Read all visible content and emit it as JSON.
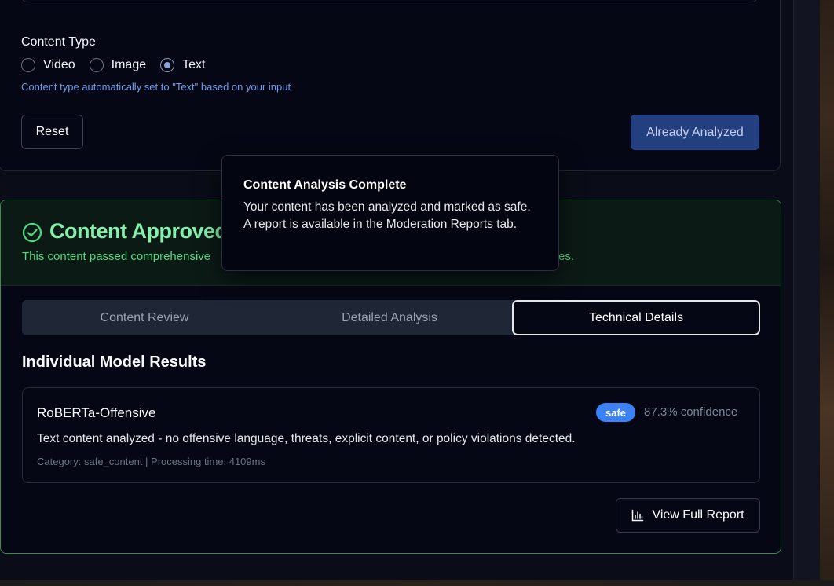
{
  "form": {
    "content_type_label": "Content Type",
    "options": [
      "Video",
      "Image",
      "Text"
    ],
    "selected": "Text",
    "hint": "Content type automatically set to \"Text\" based on your input",
    "reset_label": "Reset",
    "analyzed_label": "Already Analyzed"
  },
  "approved": {
    "title": "Content Approved",
    "subtitle_start": "This content passed comprehensive",
    "subtitle_end": "es.",
    "accent": "#4ade80"
  },
  "tabs": [
    "Content Review",
    "Detailed Analysis",
    "Technical Details"
  ],
  "active_tab": "Technical Details",
  "results": {
    "section_title": "Individual Model Results",
    "model_name": "RoBERTa-Offensive",
    "badge": "safe",
    "confidence": "87.3% confidence",
    "description": "Text content analyzed - no offensive language, threats, explicit content, or policy violations detected.",
    "meta": "Category: safe_content | Processing time: 4109ms",
    "report_label": "View Full Report"
  },
  "toast": {
    "title": "Content Analysis Complete",
    "body": "Your content has been analyzed and marked as safe. A report is available in the Moderation Reports tab."
  },
  "colors": {
    "badge": "#3b82f6",
    "approved_border": "#3b8a52",
    "primary_button": "#243f80"
  }
}
